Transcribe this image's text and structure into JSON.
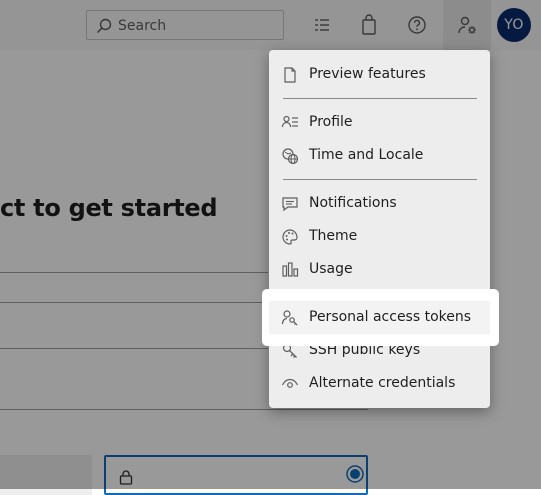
{
  "header": {
    "search_placeholder": "Search",
    "icons": [
      "search-icon",
      "work-items-icon",
      "marketplace-bag-icon",
      "help-icon",
      "user-settings-icon"
    ],
    "avatar_initials": "YO",
    "avatar_color": "#0a2b6b"
  },
  "page": {
    "headline": "ct to get started"
  },
  "menu": {
    "items": [
      {
        "label": "Preview features",
        "icon": "document-icon"
      },
      {
        "label": "Profile",
        "icon": "profile-icon"
      },
      {
        "label": "Time and Locale",
        "icon": "globe-clock-icon"
      },
      {
        "label": "Notifications",
        "icon": "chat-icon"
      },
      {
        "label": "Theme",
        "icon": "palette-icon"
      },
      {
        "label": "Usage",
        "icon": "bar-chart-icon"
      },
      {
        "label": "Personal access tokens",
        "icon": "person-key-icon"
      },
      {
        "label": "SSH public keys",
        "icon": "key-icon"
      },
      {
        "label": "Alternate credentials",
        "icon": "eye-icon"
      }
    ],
    "highlighted_item": "Personal access tokens"
  }
}
